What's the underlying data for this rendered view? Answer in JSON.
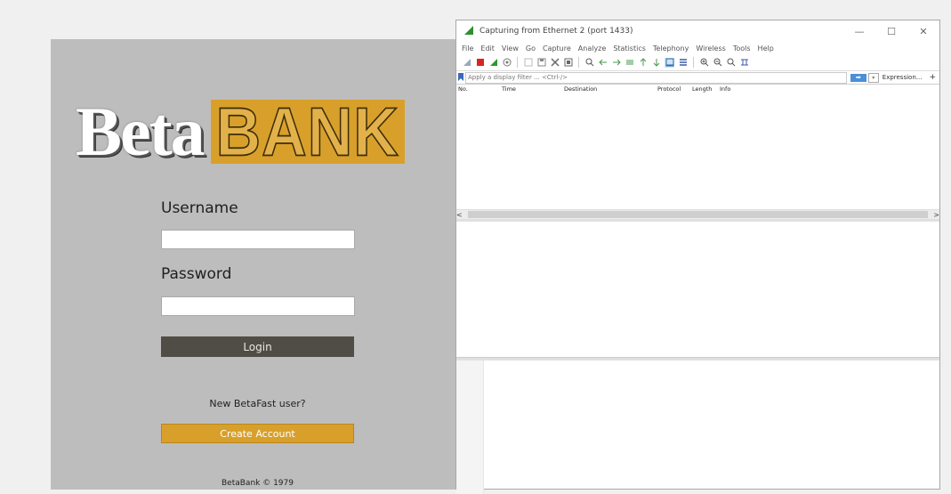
{
  "betabank": {
    "logo_left": "Beta",
    "logo_right": "BANK",
    "username_label": "Username",
    "password_label": "Password",
    "username_value": "",
    "password_value": "",
    "login_label": "Login",
    "new_user_text": "New BetaFast user?",
    "create_account_label": "Create Account",
    "footer": "BetaBank © 1979",
    "colors": {
      "panel_bg": "#bdbdbd",
      "accent_gold": "#d8a02b",
      "login_bg": "#4f4d45"
    }
  },
  "wireshark": {
    "title": "Capturing from Ethernet 2 (port 1433)",
    "window_controls": [
      "—",
      "☐",
      "✕"
    ],
    "menu": [
      "File",
      "Edit",
      "View",
      "Go",
      "Capture",
      "Analyze",
      "Statistics",
      "Telephony",
      "Wireless",
      "Tools",
      "Help"
    ],
    "filter_placeholder": "Apply a display filter ... <Ctrl-/>",
    "expression_label": "Expression...",
    "plus_label": "+",
    "columns": [
      "No.",
      "Time",
      "Destination",
      "Protocol",
      "Length",
      "Info"
    ],
    "scroll_left": "<",
    "scroll_right": ">"
  }
}
